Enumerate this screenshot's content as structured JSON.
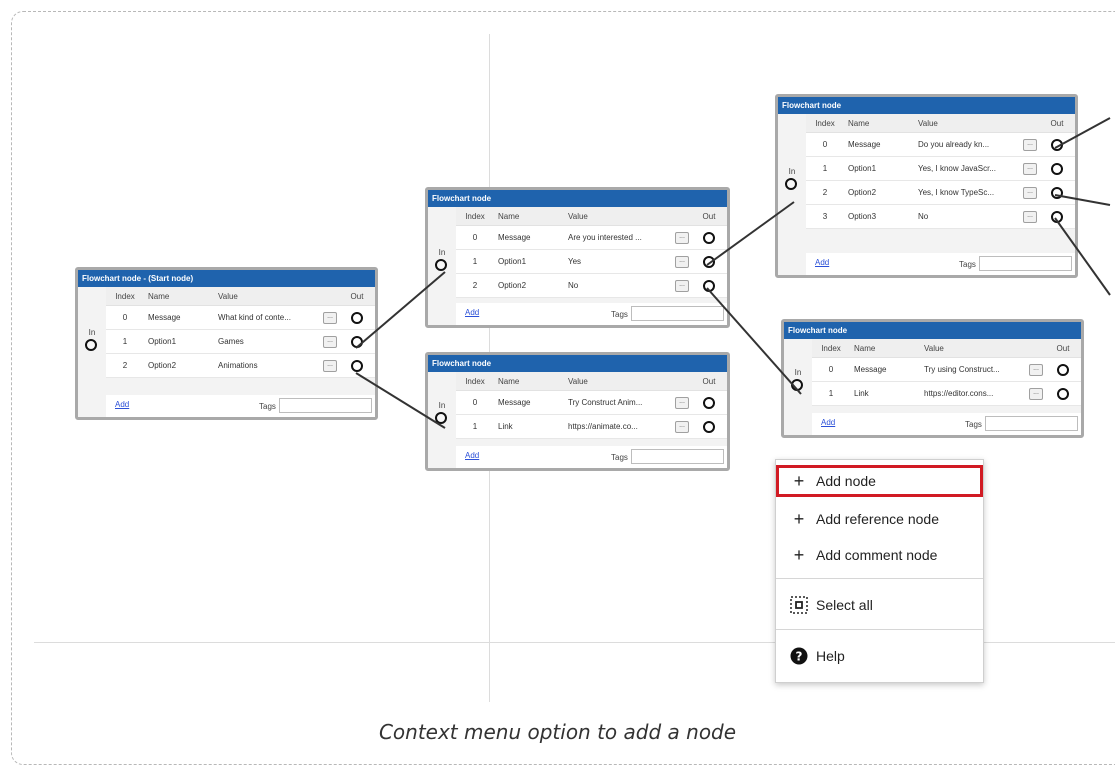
{
  "caption": "Context menu option to add a node",
  "colors": {
    "title_bar": "#1f63ad",
    "highlight": "#d11a23",
    "link": "#2a4fd8"
  },
  "node_labels": {
    "index": "Index",
    "name": "Name",
    "value": "Value",
    "out": "Out",
    "in": "In",
    "add": "Add",
    "tags": "Tags",
    "dots": "..."
  },
  "nodes": [
    {
      "title": "Flowchart node - (Start node)",
      "rows": [
        {
          "index": "0",
          "name": "Message",
          "value": "What kind of conte..."
        },
        {
          "index": "1",
          "name": "Option1",
          "value": "Games"
        },
        {
          "index": "2",
          "name": "Option2",
          "value": "Animations"
        }
      ]
    },
    {
      "title": "Flowchart node",
      "rows": [
        {
          "index": "0",
          "name": "Message",
          "value": "Are you interested ..."
        },
        {
          "index": "1",
          "name": "Option1",
          "value": "Yes"
        },
        {
          "index": "2",
          "name": "Option2",
          "value": "No"
        }
      ]
    },
    {
      "title": "Flowchart node",
      "rows": [
        {
          "index": "0",
          "name": "Message",
          "value": "Try Construct Anim..."
        },
        {
          "index": "1",
          "name": "Link",
          "value": "https://animate.co..."
        }
      ]
    },
    {
      "title": "Flowchart node",
      "rows": [
        {
          "index": "0",
          "name": "Message",
          "value": "Do you already kn..."
        },
        {
          "index": "1",
          "name": "Option1",
          "value": "Yes, I know JavaScr..."
        },
        {
          "index": "2",
          "name": "Option2",
          "value": "Yes, I know TypeSc..."
        },
        {
          "index": "3",
          "name": "Option3",
          "value": "No"
        }
      ]
    },
    {
      "title": "Flowchart node",
      "rows": [
        {
          "index": "0",
          "name": "Message",
          "value": "Try using Construct..."
        },
        {
          "index": "1",
          "name": "Link",
          "value": "https://editor.cons..."
        }
      ]
    }
  ],
  "context_menu": {
    "items": [
      {
        "icon": "plus-icon",
        "glyph": "+",
        "label": "Add node"
      },
      {
        "icon": "plus-icon",
        "glyph": "+",
        "label": "Add reference node"
      },
      {
        "icon": "plus-icon",
        "glyph": "+",
        "label": "Add comment node"
      },
      {
        "icon": "select-all-icon",
        "glyph": "",
        "label": "Select all"
      },
      {
        "icon": "help-icon",
        "glyph": "",
        "label": "Help"
      }
    ]
  }
}
